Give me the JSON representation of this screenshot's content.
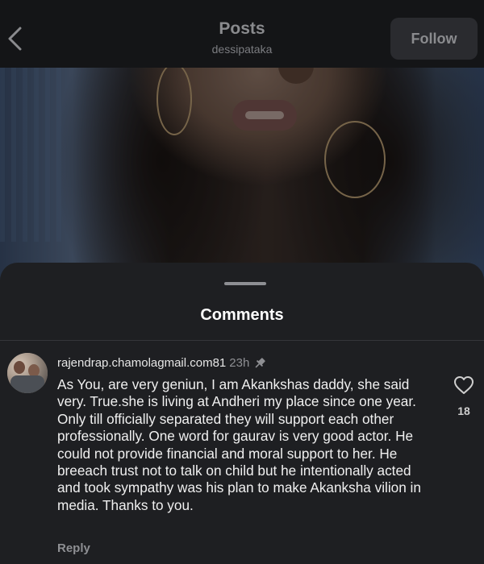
{
  "header": {
    "title": "Posts",
    "username": "dessipataka",
    "follow_label": "Follow"
  },
  "sheet": {
    "title": "Comments"
  },
  "comment": {
    "username": "rajendrap.chamolagmail.com81",
    "time": "23h",
    "text": "As You, are very geniun, I am Akankshas daddy, she said very. True.she is living at Andheri my place since one year. Only till officially separated they will support each other professionally.  One word for gaurav is very good actor. He could not provide financial and moral support to her. He breeach trust not to talk on child but he intentionally acted and took sympathy was  his plan to make Akanksha vilion in media. Thanks to you.",
    "likes": "18",
    "reply_label": "Reply"
  },
  "icons": {
    "back": "chevron-left-icon",
    "pin": "pin-icon",
    "like": "heart-icon"
  }
}
